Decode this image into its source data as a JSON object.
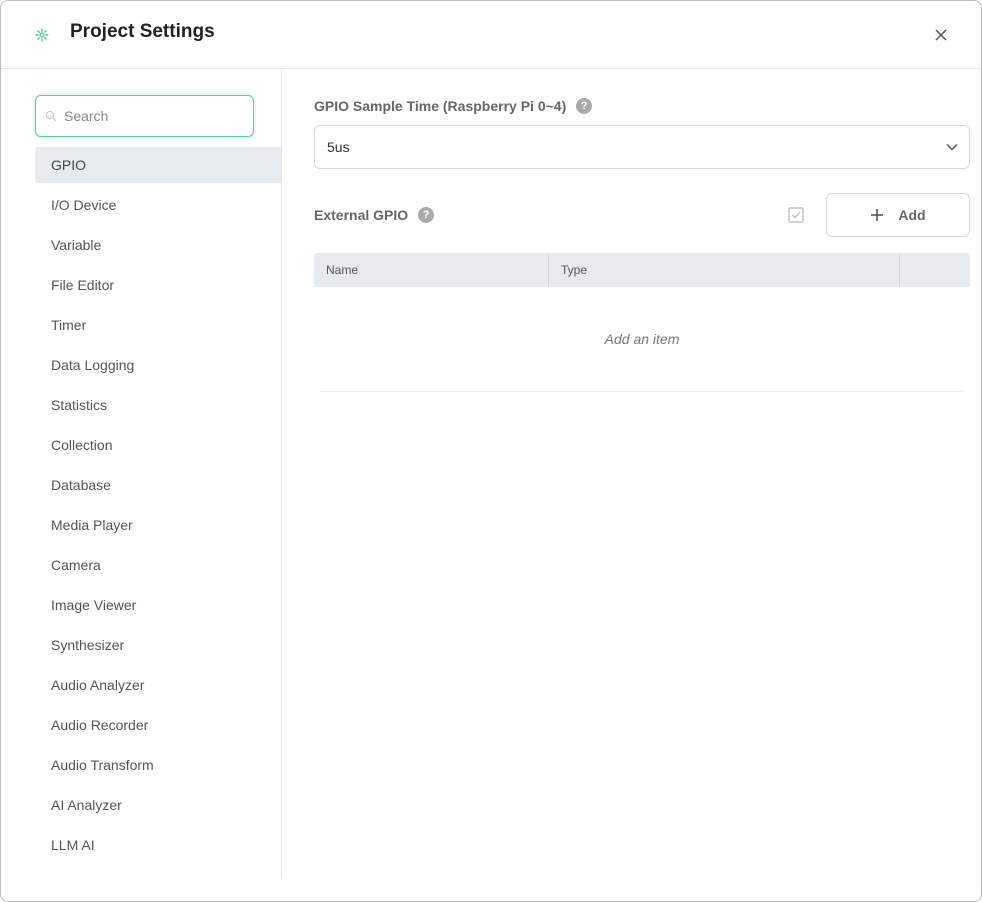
{
  "header": {
    "title": "Project Settings",
    "icon": "gear-icon",
    "close_icon": "close-icon",
    "accent_color": "#3cbf95"
  },
  "sidebar": {
    "search": {
      "placeholder": "Search",
      "value": ""
    },
    "items": [
      {
        "label": "GPIO",
        "active": true
      },
      {
        "label": "I/O Device"
      },
      {
        "label": "Variable"
      },
      {
        "label": "File Editor"
      },
      {
        "label": "Timer"
      },
      {
        "label": "Data Logging"
      },
      {
        "label": "Statistics"
      },
      {
        "label": "Collection"
      },
      {
        "label": "Database"
      },
      {
        "label": "Media Player"
      },
      {
        "label": "Camera"
      },
      {
        "label": "Image Viewer"
      },
      {
        "label": "Synthesizer"
      },
      {
        "label": "Audio Analyzer"
      },
      {
        "label": "Audio Recorder"
      },
      {
        "label": "Audio Transform"
      },
      {
        "label": "AI Analyzer"
      },
      {
        "label": "LLM AI"
      }
    ]
  },
  "main": {
    "sample_time": {
      "label": "GPIO Sample Time (Raspberry Pi 0~4)",
      "value": "5us"
    },
    "external_gpio": {
      "label": "External GPIO",
      "add_label": "Add",
      "columns": [
        "Name",
        "Type",
        ""
      ],
      "empty_text": "Add an item"
    }
  }
}
